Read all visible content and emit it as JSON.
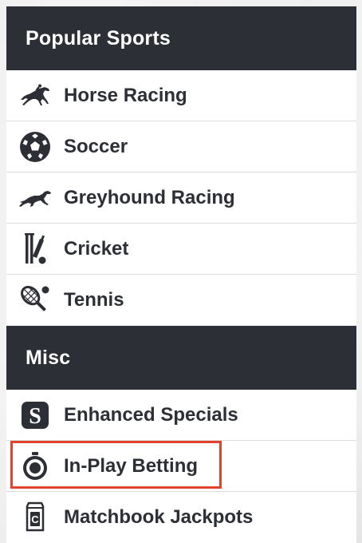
{
  "sections": [
    {
      "title": "Popular Sports",
      "items": [
        {
          "label": "Horse Racing",
          "icon": "horse-racing-icon"
        },
        {
          "label": "Soccer",
          "icon": "soccer-ball-icon"
        },
        {
          "label": "Greyhound Racing",
          "icon": "greyhound-icon"
        },
        {
          "label": "Cricket",
          "icon": "cricket-bat-ball-icon"
        },
        {
          "label": "Tennis",
          "icon": "tennis-racket-icon"
        }
      ]
    },
    {
      "title": "Misc",
      "items": [
        {
          "label": "Enhanced Specials",
          "icon": "specials-s-icon"
        },
        {
          "label": "In-Play Betting",
          "icon": "stopwatch-icon",
          "highlighted": true
        },
        {
          "label": "Matchbook Jackpots",
          "icon": "jackpot-c-icon"
        }
      ]
    }
  ],
  "colors": {
    "header_bg": "#2d2f36",
    "header_text": "#ffffff",
    "item_text": "#2d2f36",
    "divider": "#dcdcdc",
    "highlight": "#e0432b"
  }
}
